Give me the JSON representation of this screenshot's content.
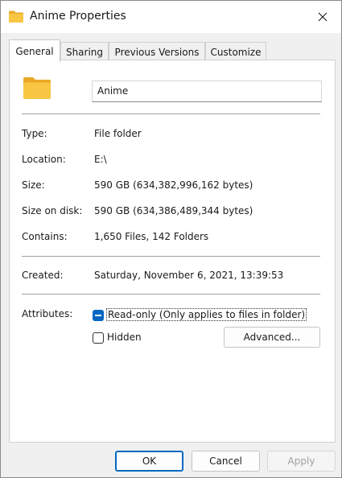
{
  "window": {
    "title": "Anime Properties",
    "icon": "folder-icon",
    "close_icon": "close-icon"
  },
  "tabs": [
    {
      "label": "General",
      "active": true
    },
    {
      "label": "Sharing",
      "active": false
    },
    {
      "label": "Previous Versions",
      "active": false
    },
    {
      "label": "Customize",
      "active": false
    }
  ],
  "general": {
    "name_value": "Anime",
    "rows": {
      "type": {
        "label": "Type:",
        "value": "File folder"
      },
      "location": {
        "label": "Location:",
        "value": "E:\\"
      },
      "size": {
        "label": "Size:",
        "value": "590 GB (634,382,996,162 bytes)"
      },
      "size_on_disk": {
        "label": "Size on disk:",
        "value": "590 GB (634,386,489,344 bytes)"
      },
      "contains": {
        "label": "Contains:",
        "value": "1,650 Files, 142 Folders"
      },
      "created": {
        "label": "Created:",
        "value": "Saturday, November 6, 2021, 13:39:53"
      }
    },
    "attributes": {
      "label": "Attributes:",
      "readonly_label": "Read-only (Only applies to files in folder)",
      "readonly_state": "indeterminate",
      "hidden_label": "Hidden",
      "hidden_checked": false,
      "advanced_label": "Advanced..."
    }
  },
  "buttons": {
    "ok": "OK",
    "cancel": "Cancel",
    "apply": "Apply"
  },
  "colors": {
    "accent": "#0067c0",
    "folder_yellow": "#f8c642",
    "disabled_text": "#a0a0a0"
  }
}
